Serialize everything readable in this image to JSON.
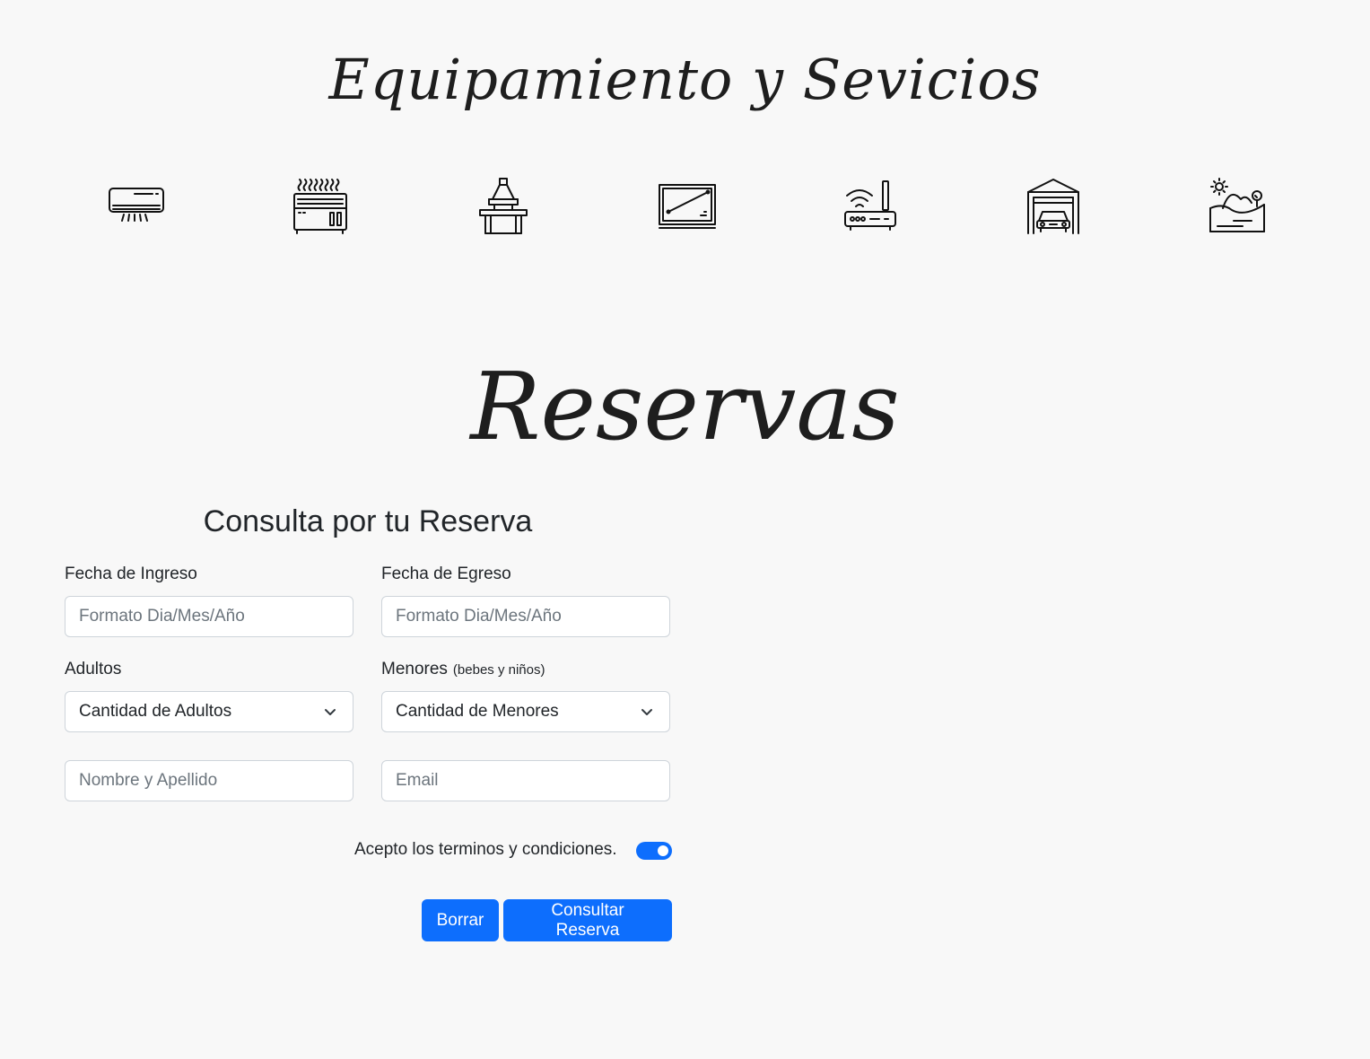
{
  "amenities": {
    "title": "Equipamiento y Sevicios",
    "icons": [
      "air-conditioner-icon",
      "heater-icon",
      "barbecue-grill-icon",
      "tv-icon",
      "wifi-router-icon",
      "garage-icon",
      "landscape-view-icon"
    ]
  },
  "reservations": {
    "title": "Reservas",
    "form": {
      "heading": "Consulta por tu Reserva",
      "checkin": {
        "label": "Fecha de Ingreso",
        "placeholder": "Formato Dia/Mes/Año",
        "value": ""
      },
      "checkout": {
        "label": "Fecha de Egreso",
        "placeholder": "Formato Dia/Mes/Año",
        "value": ""
      },
      "adults": {
        "label": "Adultos",
        "selected": "Cantidad de Adultos"
      },
      "minors": {
        "label": "Menores",
        "hint": "(bebes y niños)",
        "selected": "Cantidad de Menores"
      },
      "name": {
        "placeholder": "Nombre y Apellido",
        "value": ""
      },
      "email": {
        "placeholder": "Email",
        "value": ""
      },
      "terms": {
        "label": "Acepto los terminos y condiciones.",
        "checked": true
      },
      "buttons": {
        "clear": "Borrar",
        "submit": "Consultar Reserva"
      }
    }
  },
  "colors": {
    "background": "#f8f8f8",
    "accent": "#0d6efd",
    "text": "#212529",
    "placeholder": "#6c757d",
    "border": "#ced4da"
  }
}
